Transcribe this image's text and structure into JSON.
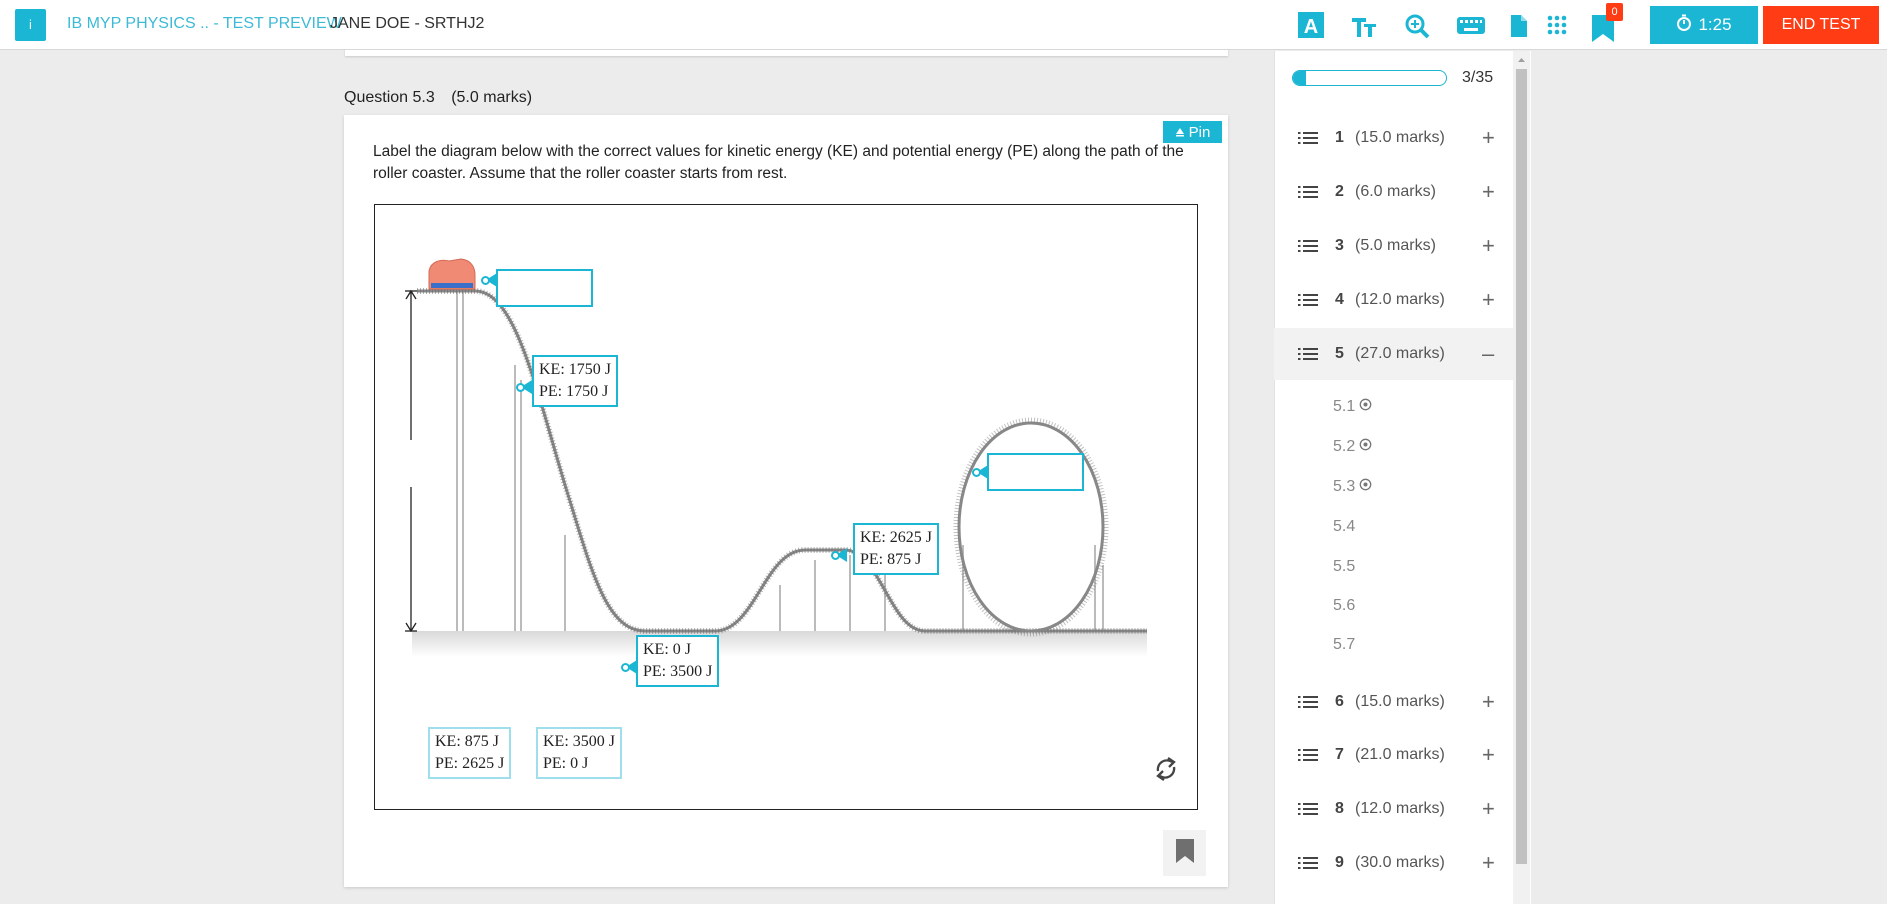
{
  "header": {
    "app_icon_text": "i",
    "title": "IB MYP PHYSICS .. - TEST PREVIEW",
    "user": "JANE DOE - SRTHJ2",
    "bookmark_count": "0",
    "timer": "1:25",
    "end_test": "END TEST",
    "icons": [
      "text-style-icon",
      "font-size-icon",
      "zoom-icon",
      "keyboard-icon",
      "document-icon",
      "grid-icon",
      "bookmark-icon"
    ],
    "accent_color": "#1bb6d3",
    "danger_color": "#ff3c14"
  },
  "question": {
    "number": "Question 5.3",
    "marks": "(5.0 marks)",
    "pin_label": "Pin",
    "text": "Label the diagram below with the correct values for kinetic energy (KE) and potential energy (PE) along the path of the roller coaster. Assume that the roller coaster starts from rest.",
    "placed_labels": [
      {
        "ke": "KE: 1750 J",
        "pe": "PE: 1750 J"
      },
      {
        "ke": "KE: 0 J",
        "pe": "PE: 3500 J"
      },
      {
        "ke": "KE: 2625 J",
        "pe": "PE: 875 J"
      }
    ],
    "label_bank": [
      {
        "ke": "KE: 875 J",
        "pe": "PE: 2625 J"
      },
      {
        "ke": "KE: 3500 J",
        "pe": "PE: 0 J"
      }
    ]
  },
  "sidebar": {
    "progress_text": "3/35",
    "progress_fraction": 0.086,
    "sections": [
      {
        "num": "1",
        "marks": "(15.0 marks)",
        "toggle": "+"
      },
      {
        "num": "2",
        "marks": "(6.0 marks)",
        "toggle": "+"
      },
      {
        "num": "3",
        "marks": "(5.0 marks)",
        "toggle": "+"
      },
      {
        "num": "4",
        "marks": "(12.0 marks)",
        "toggle": "+"
      },
      {
        "num": "5",
        "marks": "(27.0 marks)",
        "toggle": "–"
      },
      {
        "num": "6",
        "marks": "(15.0 marks)",
        "toggle": "+"
      },
      {
        "num": "7",
        "marks": "(21.0 marks)",
        "toggle": "+"
      },
      {
        "num": "8",
        "marks": "(12.0 marks)",
        "toggle": "+"
      },
      {
        "num": "9",
        "marks": "(30.0 marks)",
        "toggle": "+"
      }
    ],
    "subs": [
      "5.1",
      "5.2",
      "5.3",
      "5.4",
      "5.5",
      "5.6",
      "5.7"
    ]
  }
}
